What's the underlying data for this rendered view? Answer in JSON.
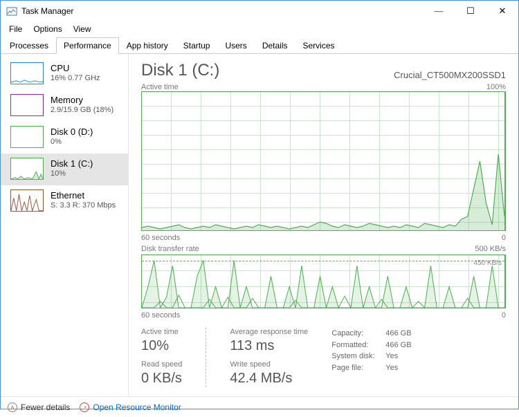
{
  "window": {
    "title": "Task Manager",
    "controls": {
      "min": "—",
      "max": "☐",
      "close": "✕"
    }
  },
  "menu": [
    "File",
    "Options",
    "View"
  ],
  "tabs": [
    "Processes",
    "Performance",
    "App history",
    "Startup",
    "Users",
    "Details",
    "Services"
  ],
  "active_tab": "Performance",
  "sidebar": [
    {
      "title": "CPU",
      "sub": "16% 0.77 GHz",
      "color": "#1E88E5"
    },
    {
      "title": "Memory",
      "sub": "2.9/15.9 GB (18%)",
      "color": "#8E24AA"
    },
    {
      "title": "Disk 0 (D:)",
      "sub": "0%",
      "color": "#4CAF50"
    },
    {
      "title": "Disk 1 (C:)",
      "sub": "10%",
      "color": "#4CAF50"
    },
    {
      "title": "Ethernet",
      "sub": "S: 3.3 R: 370 Mbps",
      "color": "#A0522D"
    }
  ],
  "selected_sidebar": 3,
  "main": {
    "title": "Disk 1 (C:)",
    "model": "Crucial_CT500MX200SSD1",
    "chart1": {
      "top_left": "Active time",
      "top_right": "100%",
      "bottom_left": "60 seconds",
      "bottom_right": "0"
    },
    "chart2": {
      "top_left": "Disk transfer rate",
      "top_right": "500 KB/s",
      "bottom_left": "60 seconds",
      "bottom_right": "0",
      "dashed_label": "450 KB/s"
    },
    "stats_primary": [
      {
        "label": "Active time",
        "value": "10%"
      },
      {
        "label": "Average response time",
        "value": "113 ms"
      }
    ],
    "stats_secondary": [
      {
        "label": "Read speed",
        "value": "0 KB/s"
      },
      {
        "label": "Write speed",
        "value": "42.4 MB/s"
      }
    ],
    "info": [
      {
        "label": "Capacity:",
        "value": "466 GB"
      },
      {
        "label": "Formatted:",
        "value": "466 GB"
      },
      {
        "label": "System disk:",
        "value": "Yes"
      },
      {
        "label": "Page file:",
        "value": "Yes"
      }
    ]
  },
  "footer": {
    "fewer": "Fewer details",
    "resmon": "Open Resource Monitor"
  },
  "chart_data": [
    {
      "type": "area",
      "title": "Active time",
      "xlabel": "60 seconds",
      "ylabel": "%",
      "ylim": [
        0,
        100
      ],
      "x": [
        0,
        1,
        2,
        3,
        4,
        5,
        6,
        7,
        8,
        9,
        10,
        11,
        12,
        13,
        14,
        15,
        16,
        17,
        18,
        19,
        20,
        21,
        22,
        23,
        24,
        25,
        26,
        27,
        28,
        29,
        30,
        31,
        32,
        33,
        34,
        35,
        36,
        37,
        38,
        39,
        40,
        41,
        42,
        43,
        44,
        45,
        46,
        47,
        48,
        49,
        50,
        51,
        52,
        53,
        54,
        55,
        56,
        57,
        58,
        59
      ],
      "values": [
        2,
        3,
        2,
        1,
        2,
        3,
        4,
        2,
        1,
        2,
        3,
        2,
        4,
        3,
        2,
        1,
        2,
        3,
        2,
        4,
        3,
        2,
        3,
        2,
        1,
        2,
        3,
        2,
        4,
        6,
        5,
        3,
        2,
        4,
        3,
        2,
        3,
        5,
        4,
        3,
        2,
        3,
        2,
        4,
        3,
        2,
        5,
        4,
        3,
        2,
        4,
        3,
        8,
        10,
        30,
        50,
        20,
        4,
        55,
        10
      ]
    },
    {
      "type": "line",
      "title": "Disk transfer rate",
      "xlabel": "60 seconds",
      "ylabel": "KB/s",
      "ylim": [
        0,
        500
      ],
      "dashed_ref": 450,
      "series": [
        {
          "name": "read",
          "values": [
            0,
            200,
            450,
            0,
            100,
            400,
            0,
            0,
            0,
            300,
            450,
            0,
            200,
            0,
            0,
            450,
            0,
            200,
            0,
            0,
            0,
            300,
            0,
            0,
            200,
            0,
            400,
            0,
            0,
            300,
            0,
            200,
            0,
            0,
            0,
            400,
            0,
            200,
            0,
            0,
            300,
            0,
            0,
            200,
            0,
            0,
            0,
            400,
            0,
            0,
            200,
            0,
            0,
            0,
            300,
            0,
            0,
            400,
            0,
            0
          ]
        },
        {
          "name": "write",
          "values": [
            0,
            0,
            0,
            60,
            0,
            0,
            120,
            0,
            0,
            0,
            0,
            80,
            0,
            0,
            100,
            0,
            0,
            0,
            90,
            0,
            0,
            0,
            0,
            0,
            0,
            70,
            0,
            0,
            0,
            0,
            0,
            0,
            0,
            110,
            0,
            0,
            0,
            0,
            0,
            80,
            0,
            0,
            0,
            0,
            0,
            60,
            0,
            0,
            0,
            0,
            0,
            0,
            0,
            90,
            0,
            0,
            0,
            0,
            0,
            0
          ]
        }
      ]
    }
  ]
}
